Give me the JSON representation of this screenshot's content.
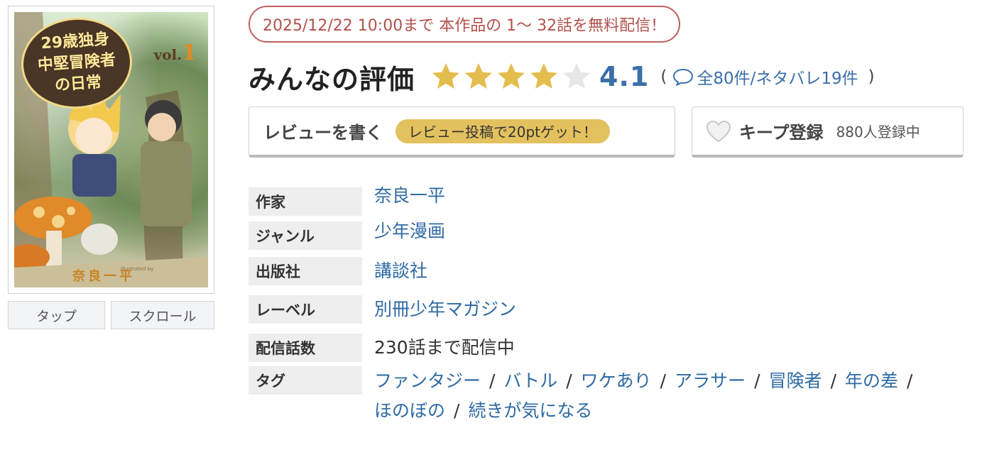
{
  "cover": {
    "title_lines": [
      "29歳独身",
      "中堅冒険者",
      "の日常"
    ],
    "volume_prefix": "vol.",
    "volume_number": "1",
    "author": "奈良一平",
    "author_small": "Illustrated by",
    "tabs": {
      "tap": "タップ",
      "scroll": "スクロール"
    }
  },
  "promo": {
    "text": "2025/12/22 10:00まで 本作品の 1〜 32話を無料配信！"
  },
  "rating": {
    "heading": "みんなの評価",
    "score": "4.1",
    "score_value": 4.1,
    "max_stars": 5,
    "star_color": "#e3bd4e",
    "star_empty_color": "#e6e6e6",
    "open_paren": "(",
    "close_paren": ")",
    "review_link": "全80件/ネタバレ19件"
  },
  "review_button": {
    "label": "レビューを書く",
    "pill": "レビュー投稿で20ptゲット！"
  },
  "keep_button": {
    "label": "キープ登録",
    "count": "880人登録中"
  },
  "info": {
    "author": {
      "label": "作家",
      "value": "奈良一平"
    },
    "genre": {
      "label": "ジャンル",
      "value": "少年漫画"
    },
    "publisher": {
      "label": "出版社",
      "value": "講談社"
    },
    "label_imprint": {
      "label": "レーベル",
      "value": "別冊少年マガジン"
    },
    "episodes": {
      "label": "配信話数",
      "value": "230話まで配信中"
    },
    "tags": {
      "label": "タグ",
      "separator": "/",
      "items": [
        "ファンタジー",
        "バトル",
        "ワケあり",
        "アラサー",
        "冒険者",
        "年の差",
        "ほのぼの",
        "続きが気になる"
      ]
    }
  },
  "colors": {
    "link": "#2f6aa3",
    "promo": "#b3504b",
    "pill": "#e3c15f"
  }
}
